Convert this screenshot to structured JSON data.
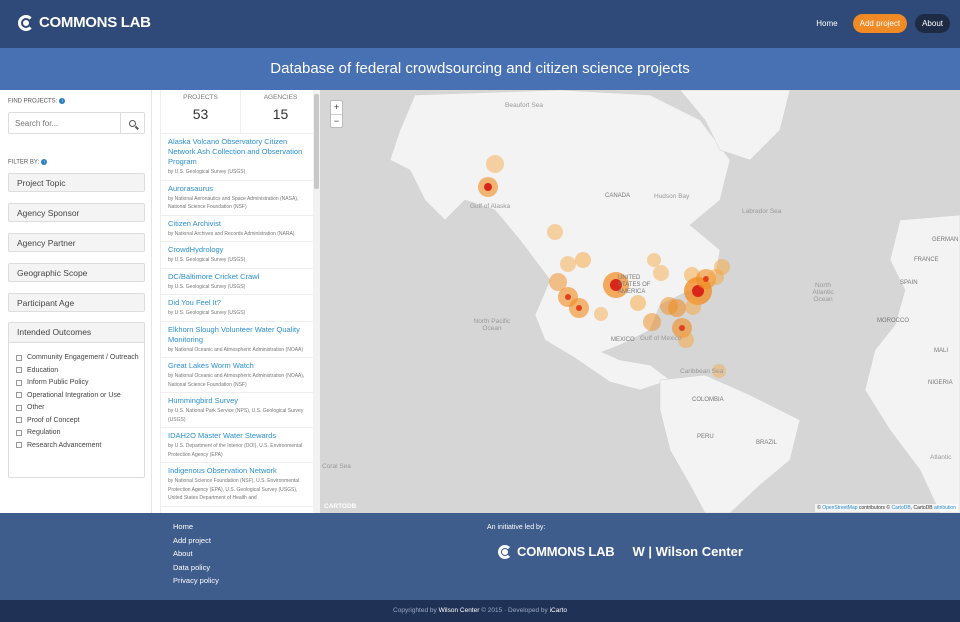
{
  "brand": {
    "name": "COMMONS LAB"
  },
  "nav": {
    "home": "Home",
    "add_project": "Add project",
    "about": "About"
  },
  "banner": {
    "title": "Database of federal crowdsourcing and citizen science projects"
  },
  "filters": {
    "find_label": "FIND PROJECTS:",
    "search_placeholder": "Search for...",
    "filter_label": "FILTER BY:",
    "buttons": [
      "Project Topic",
      "Agency Sponsor",
      "Agency Partner",
      "Geographic Scope",
      "Participant Age"
    ],
    "outcomes": {
      "title": "Intended Outcomes",
      "items": [
        "Community Engagement / Outreach",
        "Education",
        "Inform Public Policy",
        "Operational Integration or Use",
        "Other",
        "Proof of Concept",
        "Regulation",
        "Research Advancement"
      ]
    }
  },
  "stats": {
    "projects_label": "PROJECTS",
    "projects": "53",
    "agencies_label": "AGENCIES",
    "agencies": "15"
  },
  "projects": [
    {
      "title": "Alaska Volcano Observatory Citizen Network Ash Collection and Observation Program",
      "agency": "by U.S. Geological Survey (USGS)"
    },
    {
      "title": "Aurorasaurus",
      "agency": "by National Aeronautics and Space Administration (NASA), National Science Foundation (NSF)"
    },
    {
      "title": "Citizen Archivist",
      "agency": "by National Archives and Records Administration (NARA)"
    },
    {
      "title": "CrowdHydrology",
      "agency": "by U.S. Geological Survey (USGS)"
    },
    {
      "title": "DC/Baltimore Cricket Crawl",
      "agency": "by U.S. Geological Survey (USGS)"
    },
    {
      "title": "Did You Feel It?",
      "agency": "by U.S. Geological Survey (USGS)"
    },
    {
      "title": "Elkhorn Slough Volunteer Water Quality Monitoring",
      "agency": "by National Oceanic and Atmospheric Administration (NOAA)"
    },
    {
      "title": "Great Lakes Worm Watch",
      "agency": "by National Oceanic and Atmospheric Administration (NOAA), National Science Foundation (NSF)"
    },
    {
      "title": "Hummingbird Survey",
      "agency": "by U.S. National Park Service (NPS), U.S. Geological Survey (USGS)"
    },
    {
      "title": "IDAH2O Master Water Stewards",
      "agency": "by U.S. Department of the Interior (DOI), U.S. Environmental Protection Agency (EPA)"
    },
    {
      "title": "Indigenous Observation Network",
      "agency": "by National Science Foundation (NSF), U.S. Environmental Protection Agency (EPA), U.S. Geological Survey (USGS), United States Department of Health and"
    }
  ],
  "map": {
    "zoom_in": "+",
    "zoom_out": "−",
    "labels": {
      "beaufort": "Beaufort Sea",
      "alaska": "Gulf of Alaska",
      "canada": "CANADA",
      "hudson": "Hudson Bay",
      "labrador": "Labrador Sea",
      "germany": "GERMAN",
      "france": "FRANCE",
      "spain": "SPAIN",
      "us": "UNITED STATES OF AMERICA",
      "npacific": "North Pacific Ocean",
      "natlantic": "North Atlantic Ocean",
      "morocco": "MOROCCO",
      "mexico": "MEXICO",
      "gulf": "Gulf of Mexico",
      "caribbean": "Caribbean Sea",
      "mali": "MALI",
      "niger": "NIGERIA",
      "colombia": "COLOMBIA",
      "peru": "PERU",
      "brazil": "BRAZIL",
      "coral": "Coral Sea",
      "atlantic": "Atlantic",
      "cartodb": "CARTODB"
    },
    "attribution_pre": "© ",
    "attribution_osm": "OpenStreetMap",
    "attribution_mid": " contributors © ",
    "attribution_carto": "CartoDB",
    "attribution_post": ", CartoDB ",
    "attribution_link": "attribution"
  },
  "footer": {
    "links": [
      "Home",
      "Add project",
      "About",
      "Data policy",
      "Privacy policy"
    ],
    "initiative": "An initiative led by:",
    "partner1": "COMMONS LAB",
    "partner2": "W | Wilson Center"
  },
  "copyright": {
    "pre": "Copyrighted by ",
    "org": "Wilson Center",
    "mid": " © 2015 · Developed by ",
    "dev": "iCarto"
  },
  "colors": {
    "header": "#2f4a78",
    "banner": "#4771b3",
    "accent": "#f08a24",
    "link": "#2b8fcf",
    "footer": "#3e5c8c"
  }
}
